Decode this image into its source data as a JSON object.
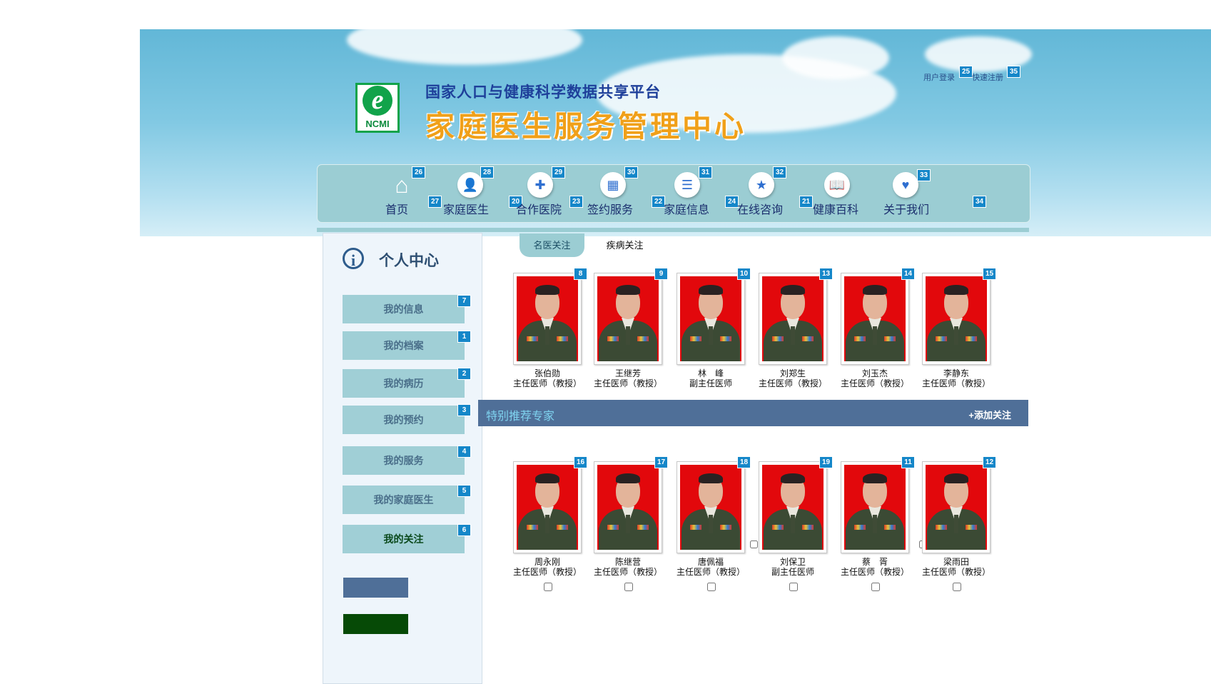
{
  "header": {
    "subtitle": "国家人口与健康科学数据共享平台",
    "title": "家庭医生服务管理中心",
    "logo_text": "NCMI",
    "login_link": "用户登录",
    "login_badge": "25",
    "register_link": "快速注册",
    "register_badge": "35"
  },
  "nav": {
    "items": [
      {
        "label": "首页",
        "icon": "home-icon",
        "badge": "26"
      },
      {
        "label": "家庭医生",
        "icon": "doctor-icon",
        "badge": "28"
      },
      {
        "label": "合作医院",
        "icon": "hospital-kit-icon",
        "badge": "29"
      },
      {
        "label": "签约服务",
        "icon": "calendar-icon",
        "badge": "30"
      },
      {
        "label": "家庭信息",
        "icon": "document-icon",
        "badge": "31"
      },
      {
        "label": "在线咨询",
        "icon": "star-chat-icon",
        "badge": "32"
      },
      {
        "label": "健康百科",
        "icon": "book-icon",
        "badge": ""
      },
      {
        "label": "关于我们",
        "icon": "handshake-icon",
        "badge": "33"
      }
    ],
    "between_badges": [
      "27",
      "20",
      "23",
      "22",
      "24",
      "21",
      "34"
    ]
  },
  "sidebar": {
    "title": "个人中心",
    "items": [
      {
        "label": "我的信息",
        "badge": "7"
      },
      {
        "label": "我的档案",
        "badge": "1"
      },
      {
        "label": "我的病历",
        "badge": "2"
      },
      {
        "label": "我的预约",
        "badge": "3"
      },
      {
        "label": "我的服务",
        "badge": "4"
      },
      {
        "label": "我的家庭医生",
        "badge": "5"
      },
      {
        "label": "我的关注",
        "badge": "6"
      }
    ]
  },
  "tabs": {
    "famous": "名医关注",
    "disease": "疾病关注"
  },
  "followed_doctors": [
    {
      "name": "张伯勋",
      "title": "主任医师（教授）",
      "badge": "8"
    },
    {
      "name": "王继芳",
      "title": "主任医师（教授）",
      "badge": "9"
    },
    {
      "name": "林　峰",
      "title": "副主任医师",
      "badge": "10"
    },
    {
      "name": "刘郑生",
      "title": "主任医师（教授）",
      "badge": "13"
    },
    {
      "name": "刘玉杰",
      "title": "主任医师（教授）",
      "badge": "14"
    },
    {
      "name": "李静东",
      "title": "主任医师（教授）",
      "badge": "15"
    }
  ],
  "recommended": {
    "title": "特别推荐专家",
    "add_label": "+添加关注",
    "doctors": [
      {
        "name": "周永刚",
        "title": "主任医师（教授）",
        "badge": "16"
      },
      {
        "name": "陈继营",
        "title": "主任医师（教授）",
        "badge": "17"
      },
      {
        "name": "唐佩福",
        "title": "主任医师（教授）",
        "badge": "18"
      },
      {
        "name": "刘保卫",
        "title": "副主任医师",
        "badge": "19"
      },
      {
        "name": "蔡　胥",
        "title": "主任医师（教授）",
        "badge": "11"
      },
      {
        "name": "梁雨田",
        "title": "主任医师（教授）",
        "badge": "12"
      }
    ]
  }
}
